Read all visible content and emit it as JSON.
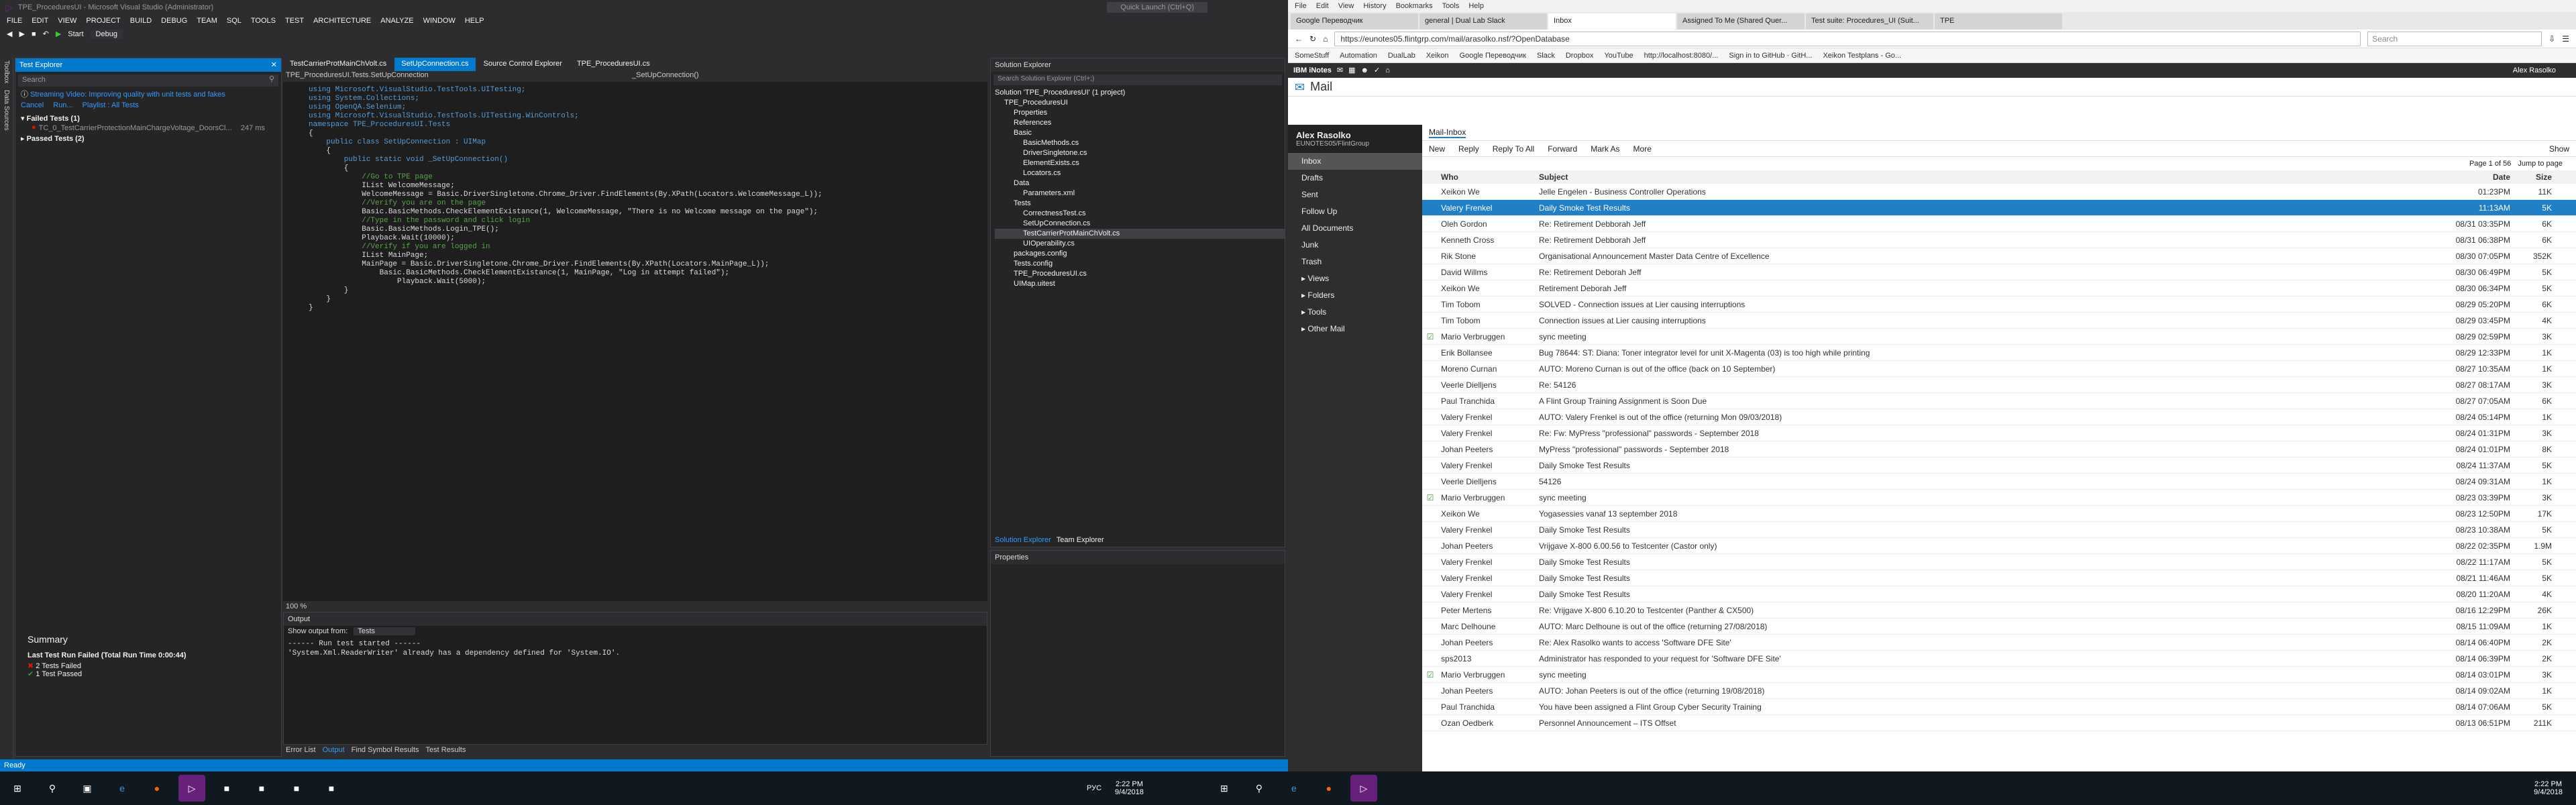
{
  "vs": {
    "title": "TPE_ProceduresUI - Microsoft Visual Studio (Administrator)",
    "quick_launch": "Quick Launch (Ctrl+Q)",
    "menu": [
      "FILE",
      "EDIT",
      "VIEW",
      "PROJECT",
      "BUILD",
      "DEBUG",
      "TEAM",
      "SQL",
      "TOOLS",
      "TEST",
      "ARCHITECTURE",
      "ANALYZE",
      "WINDOW",
      "HELP"
    ],
    "toolbar": {
      "start": "Start",
      "config": "Debug"
    },
    "strip": [
      "Toolbox",
      "Data Sources"
    ],
    "test_explorer": {
      "title": "Test Explorer",
      "search": "Search",
      "banner": "Streaming Video: Improving quality with unit tests and fakes",
      "run": "Run...",
      "playlist": "Playlist : All Tests",
      "failed_header": "Failed Tests (1)",
      "failed_item": "TC_0_TestCarrierProtectionMainChargeVoltage_DoorsCl...",
      "failed_time": "247 ms",
      "passed_header": "Passed Tests (2)",
      "summary_title": "Summary",
      "summary_line": "Last Test Run Failed (Total Run Time 0:00:44)",
      "failed_count": "2 Tests Failed",
      "passed_count": "1 Test Passed"
    },
    "tabs": [
      "TestCarrierProtMainChVolt.cs",
      "SetUpConnection.cs",
      "Source Control Explorer",
      "TPE_ProceduresUI.cs"
    ],
    "path": "TPE_ProceduresUI.Tests.SetUpConnection",
    "method": "_SetUpConnection()",
    "code": [
      "using Microsoft.VisualStudio.TestTools.UITesting;",
      "using System.Collections;",
      "using OpenQA.Selenium;",
      "using Microsoft.VisualStudio.TestTools.UITesting.WinControls;",
      "",
      "namespace TPE_ProceduresUI.Tests",
      "{",
      "    public class SetUpConnection : UIMap",
      "    {",
      "        public static void _SetUpConnection()",
      "        {",
      "            //Go to TPE page",
      "            IList WelcomeMessage;",
      "            WelcomeMessage = Basic.DriverSingletone.Chrome_Driver.FindElements(By.XPath(Locators.WelcomeMessage_L));",
      "",
      "            //Verify you are on the page",
      "            Basic.BasicMethods.CheckElementExistance(1, WelcomeMessage, \"There is no Welcome message on the page\");",
      "",
      "            //Type in the password and click login",
      "            Basic.BasicMethods.Login_TPE();",
      "            Playback.Wait(10000);",
      "",
      "            //Verify if you are logged in",
      "            IList MainPage;",
      "            MainPage = Basic.DriverSingletone.Chrome_Driver.FindElements(By.XPath(Locators.MainPage_L));",
      "                Basic.BasicMethods.CheckElementExistance(1, MainPage, \"Log in attempt failed\");",
      "                    Playback.Wait(5000);",
      "",
      "",
      "        }",
      "    }",
      "}"
    ],
    "zoom": "100 %",
    "output": {
      "title": "Output",
      "show_from": "Show output from:",
      "source": "Tests",
      "line1": "------ Run test started ------",
      "line2": "'System.Xml.ReaderWriter' already has a dependency defined for 'System.IO'."
    },
    "bottom_tabs": [
      "Error List",
      "Output",
      "Find Symbol Results",
      "Test Results"
    ],
    "solution": {
      "title": "Solution Explorer",
      "search": "Search Solution Explorer (Ctrl+;)",
      "items": [
        "Solution 'TPE_ProceduresUI' (1 project)",
        "TPE_ProceduresUI",
        "Properties",
        "References",
        "Basic",
        "BasicMethods.cs",
        "DriverSingletone.cs",
        "ElementExists.cs",
        "Locators.cs",
        "Data",
        "Parameters.xml",
        "Tests",
        "CorrectnessTest.cs",
        "SetUpConnection.cs",
        "TestCarrierProtMainChVolt.cs",
        "UIOperability.cs",
        "packages.config",
        "Tests.config",
        "TPE_ProceduresUI.cs",
        "UIMap.uitest"
      ],
      "footer_tabs": [
        "Solution Explorer",
        "Team Explorer"
      ],
      "properties": "Properties"
    },
    "status": "Ready"
  },
  "browser": {
    "menu": [
      "File",
      "Edit",
      "View",
      "History",
      "Bookmarks",
      "Tools",
      "Help"
    ],
    "tabs": [
      "Google Переводчик",
      "general | Dual Lab Slack",
      "Inbox",
      "Assigned To Me (Shared Quer...",
      "Test suite: Procedures_UI (Suit...",
      "TPE"
    ],
    "url": "https://eunotes05.flintgrp.com/mail/arasolko.nsf/?OpenDatabase",
    "search_placeholder": "Search",
    "bookmarks": [
      "SomeStuff",
      "Automation",
      "DualLab",
      "Xeikon",
      "Google Переводчик",
      "Slack",
      "Dropbox",
      "YouTube",
      "http://localhost:8080/...",
      "Sign in to GitHub · GitH...",
      "Xeikon Testplans - Go..."
    ],
    "notes_label": "IBM iNotes",
    "user": "Alex Rasolko",
    "mail_title": "Mail",
    "mail_tab": "Mail-Inbox",
    "owner": "Alex Rasolko",
    "owner_org": "EUNOTES05/FlintGroup",
    "folders": [
      "Inbox",
      "Drafts",
      "Sent",
      "Follow Up",
      "All Documents",
      "Junk",
      "Trash"
    ],
    "sections": [
      "Views",
      "Folders",
      "Tools",
      "Other Mail"
    ],
    "toolbar": [
      "New",
      "Reply",
      "Reply To All",
      "Forward",
      "Mark As",
      "More"
    ],
    "show": "Show",
    "paging": "Page 1 of 56",
    "jump": "Jump to page",
    "cols": {
      "who": "Who",
      "subject": "Subject",
      "date": "Date",
      "size": "Size"
    },
    "rows": [
      {
        "who": "Xeikon We",
        "subject": "Jelle Engelen - Business Controller Operations",
        "date": "01:23PM",
        "size": "11K",
        "flag": ""
      },
      {
        "who": "Valery Frenkel",
        "subject": "Daily Smoke Test Results",
        "date": "11:13AM",
        "size": "5K",
        "flag": ""
      },
      {
        "who": "Oleh Gordon",
        "subject": "Re: Retirement Debborah Jeff",
        "date": "08/31 03:35PM",
        "size": "6K",
        "flag": ""
      },
      {
        "who": "Kenneth Cross",
        "subject": "Re: Retirement Debborah Jeff",
        "date": "08/31 06:38PM",
        "size": "6K",
        "flag": ""
      },
      {
        "who": "Rik Stone",
        "subject": "Organisational Announcement Master Data Centre of Excellence",
        "date": "08/30 07:05PM",
        "size": "352K",
        "flag": ""
      },
      {
        "who": "David Willms",
        "subject": "Re: Retirement Deborah Jeff",
        "date": "08/30 06:49PM",
        "size": "5K",
        "flag": ""
      },
      {
        "who": "Xeikon We",
        "subject": "Retirement Deborah Jeff",
        "date": "08/30 06:34PM",
        "size": "5K",
        "flag": ""
      },
      {
        "who": "Tim Tobom",
        "subject": "SOLVED - Connection issues at Lier causing interruptions",
        "date": "08/29 05:20PM",
        "size": "6K",
        "flag": ""
      },
      {
        "who": "Tim Tobom",
        "subject": "Connection issues at Lier causing interruptions",
        "date": "08/29 03:45PM",
        "size": "4K",
        "flag": ""
      },
      {
        "who": "Mario Verbruggen",
        "subject": "sync meeting",
        "date": "08/29 02:59PM",
        "size": "3K",
        "flag": "check"
      },
      {
        "who": "Erik Bollansee",
        "subject": "Bug 78644: ST: Diana: Toner integrator level for unit X-Magenta (03) is too high while printing",
        "date": "08/29 12:33PM",
        "size": "1K",
        "flag": ""
      },
      {
        "who": "Moreno Curnan",
        "subject": "AUTO: Moreno Curnan is out of the office (back on 10 September)",
        "date": "08/27 10:35AM",
        "size": "1K",
        "flag": ""
      },
      {
        "who": "Veerle Dielljens",
        "subject": "Re: 54126",
        "date": "08/27 08:17AM",
        "size": "3K",
        "flag": ""
      },
      {
        "who": "Paul Tranchida",
        "subject": "A Flint Group Training Assignment is Soon Due",
        "date": "08/27 07:05AM",
        "size": "6K",
        "flag": ""
      },
      {
        "who": "Valery Frenkel",
        "subject": "AUTO: Valery Frenkel is out of the office (returning Mon 09/03/2018)",
        "date": "08/24 05:14PM",
        "size": "1K",
        "flag": ""
      },
      {
        "who": "Valery Frenkel",
        "subject": "Re: Fw: MyPress \"professional\" passwords - September 2018",
        "date": "08/24 01:31PM",
        "size": "3K",
        "flag": ""
      },
      {
        "who": "Johan Peeters",
        "subject": "MyPress \"professional\" passwords - September 2018",
        "date": "08/24 01:01PM",
        "size": "8K",
        "flag": ""
      },
      {
        "who": "Valery Frenkel",
        "subject": "Daily Smoke Test Results",
        "date": "08/24 11:37AM",
        "size": "5K",
        "flag": ""
      },
      {
        "who": "Veerle Dielljens",
        "subject": "54126",
        "date": "08/24 09:31AM",
        "size": "1K",
        "flag": ""
      },
      {
        "who": "Mario Verbruggen",
        "subject": "sync meeting",
        "date": "08/23 03:39PM",
        "size": "3K",
        "flag": "check"
      },
      {
        "who": "Xeikon We",
        "subject": "Yogasessies vanaf 13 september 2018",
        "date": "08/23 12:50PM",
        "size": "17K",
        "flag": ""
      },
      {
        "who": "Valery Frenkel",
        "subject": "Daily Smoke Test Results",
        "date": "08/23 10:38AM",
        "size": "5K",
        "flag": ""
      },
      {
        "who": "Johan Peeters",
        "subject": "Vrijgave X-800 6.00.56 to Testcenter (Castor only)",
        "date": "08/22 02:35PM",
        "size": "1.9M",
        "flag": ""
      },
      {
        "who": "Valery Frenkel",
        "subject": "Daily Smoke Test Results",
        "date": "08/22 11:17AM",
        "size": "5K",
        "flag": ""
      },
      {
        "who": "Valery Frenkel",
        "subject": "Daily Smoke Test Results",
        "date": "08/21 11:46AM",
        "size": "5K",
        "flag": ""
      },
      {
        "who": "Valery Frenkel",
        "subject": "Daily Smoke Test Results",
        "date": "08/20 11:20AM",
        "size": "4K",
        "flag": ""
      },
      {
        "who": "Peter Mertens",
        "subject": "Re: Vrijgave X-800 6.10.20 to Testcenter (Panther & CX500)",
        "date": "08/16 12:29PM",
        "size": "26K",
        "flag": ""
      },
      {
        "who": "Marc Delhoune",
        "subject": "AUTO: Marc Delhoune is out of the office (returning 27/08/2018)",
        "date": "08/15 11:09AM",
        "size": "1K",
        "flag": ""
      },
      {
        "who": "Johan Peeters",
        "subject": "Re: Alex Rasolko wants to access 'Software DFE Site'",
        "date": "08/14 06:40PM",
        "size": "2K",
        "flag": ""
      },
      {
        "who": "sps2013",
        "subject": "Administrator has responded to your request for 'Software DFE Site'",
        "date": "08/14 06:39PM",
        "size": "2K",
        "flag": ""
      },
      {
        "who": "Mario Verbruggen",
        "subject": "sync meeting",
        "date": "08/14 03:01PM",
        "size": "3K",
        "flag": "check"
      },
      {
        "who": "Johan Peeters",
        "subject": "AUTO: Johan Peeters is out of the office (returning 19/08/2018)",
        "date": "08/14 09:02AM",
        "size": "1K",
        "flag": ""
      },
      {
        "who": "Paul Tranchida",
        "subject": "You have been assigned a Flint Group Cyber Security Training",
        "date": "08/14 07:06AM",
        "size": "5K",
        "flag": ""
      },
      {
        "who": "Ozan Oedberk",
        "subject": "Personnel Announcement – ITS Offset",
        "date": "08/13 06:51PM",
        "size": "211K",
        "flag": ""
      }
    ]
  },
  "taskbar": {
    "lang": "РУС",
    "time_left": "2:22 PM",
    "date_left": "9/4/2018",
    "time_right": "2:22 PM",
    "date_right": "9/4/2018",
    "icons": [
      "start-icon",
      "search-icon",
      "task-view-icon",
      "edge-icon",
      "firefox-icon",
      "vs-icon",
      "app-icon",
      "app-icon",
      "app-icon",
      "app-icon",
      "app-icon",
      "app-icon",
      "app-icon",
      "app-icon"
    ]
  },
  "colors": {
    "vs_accent": "#007acc",
    "mail_select": "#1f7fc7",
    "fail": "#e51400",
    "pass": "#339933"
  }
}
